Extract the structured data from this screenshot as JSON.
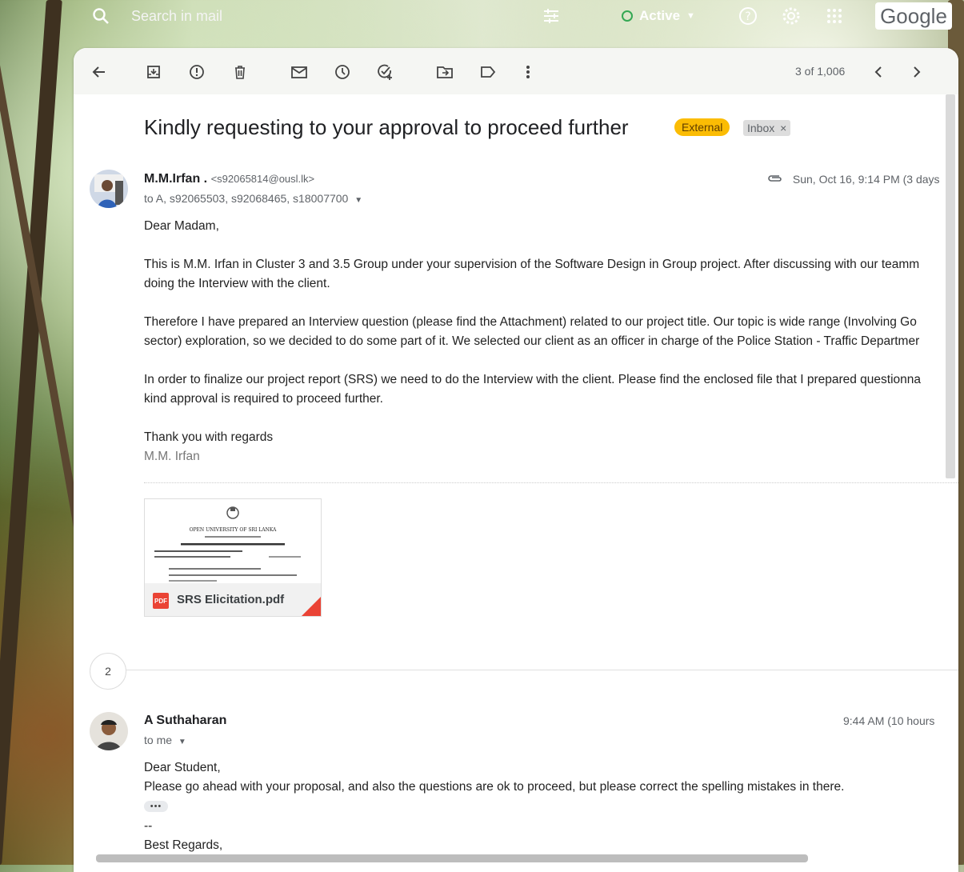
{
  "topbar": {
    "search_placeholder": "Search in mail",
    "status_label": "Active",
    "google_logo": "Google",
    "icons": [
      "search-icon",
      "filter-icon",
      "help-icon",
      "settings-icon",
      "apps-icon"
    ]
  },
  "toolbar": {
    "icons": [
      "back-icon",
      "archive-icon",
      "report-spam-icon",
      "delete-icon",
      "mark-unread-icon",
      "snooze-icon",
      "add-task-icon",
      "move-to-icon",
      "label-icon",
      "more-icon",
      "newer-icon",
      "older-icon"
    ],
    "counter": "3 of 1,006"
  },
  "thread": {
    "subject": "Kindly requesting to your approval to proceed further",
    "labels": {
      "external": "External",
      "inbox": "Inbox",
      "inbox_remove": "×"
    },
    "message1": {
      "sender_name": "M.M.Irfan .",
      "sender_email": "<s92065814@ousl.lk>",
      "to": "to A, s92065503, s92068465, s18007700",
      "date": "Sun, Oct 16, 9:14 PM (3 days",
      "greeting": "Dear Madam,",
      "para1_line1": "This is M.M. Irfan in Cluster 3 and 3.5 Group under your supervision of the Software Design in Group project. After discussing with our teamm",
      "para1_line2": "doing the Interview with the client.",
      "para2_line1": "Therefore I have prepared an Interview question (please find the Attachment) related to our project title. Our topic is wide range (Involving Go",
      "para2_line2": "sector) exploration, so we decided to do some part of it. We selected our client as an officer in charge of the Police Station - Traffic Departmer",
      "para3_line1": "In order to finalize our project report (SRS) we need to do the Interview with the client. Please find the enclosed file that I prepared questionna",
      "para3_line2": "kind approval is required to proceed further.",
      "closing": "Thank you with regards",
      "signature": "M.M. Irfan",
      "attachment": {
        "name": "SRS Elicitation.pdf",
        "type_label": "PDF",
        "preview_title": "OPEN UNIVERSITY OF SRI LANKA"
      }
    },
    "collapsed_count": "2",
    "message2": {
      "sender_name": "A Suthaharan",
      "to": "to me",
      "date": "9:44 AM (10 hours",
      "greeting": "Dear Student,",
      "line1": "Please go ahead with your proposal, and also the questions are ok to proceed, but please correct the spelling mistakes in there.",
      "dots": "•••",
      "sig_sep": "--",
      "regards": "Best Regards,"
    }
  },
  "colors": {
    "external_badge": "#fbbc04",
    "active_status": "#34a853",
    "pdf_red": "#ea4335"
  }
}
